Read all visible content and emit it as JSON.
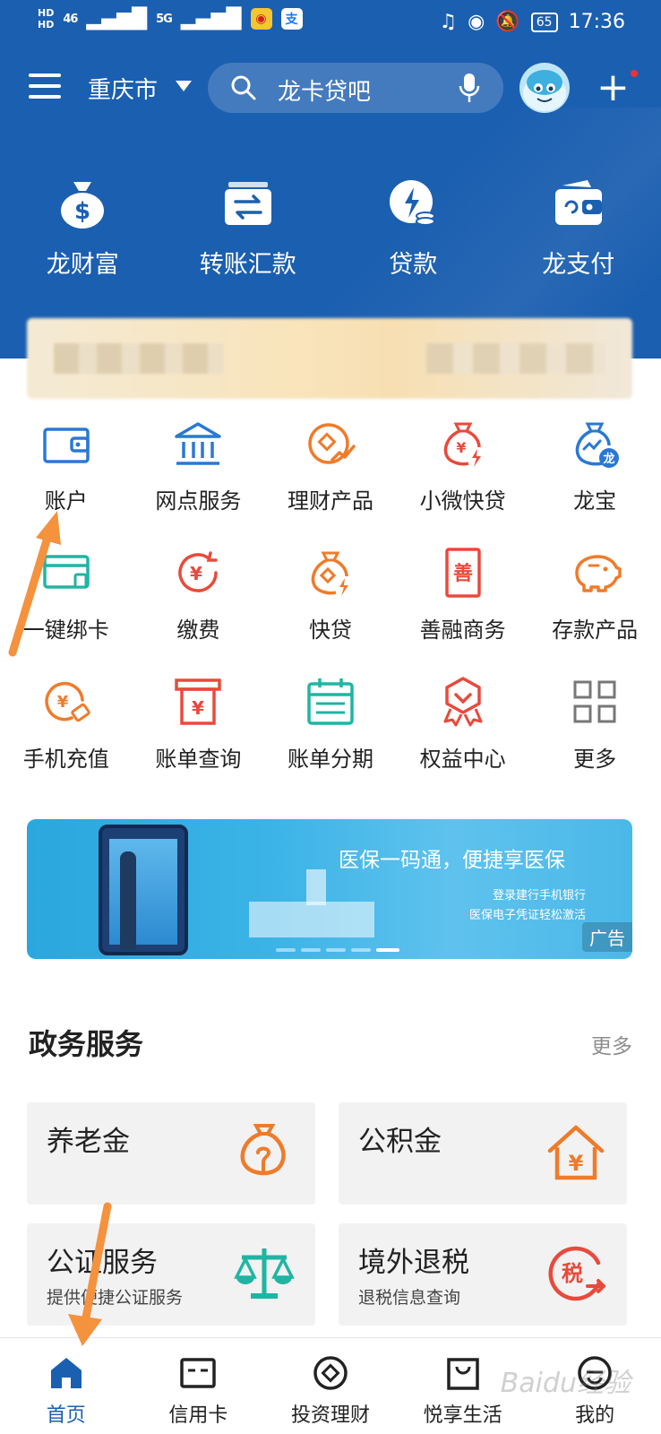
{
  "status_bar": {
    "hd1": "HD",
    "hd2": "HD",
    "sig1": "46",
    "sig2": "5G",
    "battery": "65",
    "time": "17:36"
  },
  "nav": {
    "city": "重庆市",
    "search_placeholder": "龙卡贷吧"
  },
  "quick": [
    {
      "label": "龙财富",
      "icon": "money-bag-icon"
    },
    {
      "label": "转账汇款",
      "icon": "transfer-icon"
    },
    {
      "label": "贷款",
      "icon": "loan-icon"
    },
    {
      "label": "龙支付",
      "icon": "wallet-icon"
    }
  ],
  "grid": [
    [
      {
        "label": "账户",
        "icon": "wallet-icon"
      },
      {
        "label": "网点服务",
        "icon": "bank-icon"
      },
      {
        "label": "理财产品",
        "icon": "coin-chart-icon"
      },
      {
        "label": "小微快贷",
        "icon": "money-bag-bolt-icon"
      },
      {
        "label": "龙宝",
        "icon": "dragon-bag-icon"
      }
    ],
    [
      {
        "label": "一键绑卡",
        "icon": "card-bind-icon"
      },
      {
        "label": "缴费",
        "icon": "yuan-circle-icon"
      },
      {
        "label": "快贷",
        "icon": "money-bag-bolt-icon"
      },
      {
        "label": "善融商务",
        "icon": "shan-icon"
      },
      {
        "label": "存款产品",
        "icon": "piggy-bank-icon"
      }
    ],
    [
      {
        "label": "手机充值",
        "icon": "recharge-icon"
      },
      {
        "label": "账单查询",
        "icon": "bill-query-icon"
      },
      {
        "label": "账单分期",
        "icon": "calendar-icon"
      },
      {
        "label": "权益中心",
        "icon": "badge-icon"
      },
      {
        "label": "更多",
        "icon": "grid-more-icon"
      }
    ]
  ],
  "banner": {
    "headline": "医保一码通，便捷享医保",
    "line1": "登录建行手机银行",
    "line2": "医保电子凭证轻松激活",
    "ad": "广告"
  },
  "gov": {
    "title": "政务服务",
    "more": "更多",
    "cards": [
      {
        "title": "养老金",
        "subtitle": "",
        "icon": "pension-bag-icon"
      },
      {
        "title": "公积金",
        "subtitle": "",
        "icon": "house-yuan-icon"
      },
      {
        "title": "公证服务",
        "subtitle": "提供便捷公证服务",
        "icon": "scale-icon"
      },
      {
        "title": "境外退税",
        "subtitle": "退税信息查询",
        "icon": "tax-refund-icon"
      }
    ]
  },
  "tabs": [
    {
      "label": "首页",
      "icon": "home-icon",
      "active": true
    },
    {
      "label": "信用卡",
      "icon": "credit-card-icon",
      "active": false
    },
    {
      "label": "投资理财",
      "icon": "invest-icon",
      "active": false
    },
    {
      "label": "悦享生活",
      "icon": "shopping-bag-icon",
      "active": false
    },
    {
      "label": "我的",
      "icon": "profile-icon",
      "active": false
    }
  ],
  "colors": {
    "brand_blue": "#1b5fb0",
    "icon_orange": "#ef7b2a",
    "icon_red": "#e84a3c",
    "icon_blue": "#2a78d4",
    "icon_teal": "#1fb5a3",
    "annotation_arrow": "#f5923e"
  },
  "watermark": "Baidu经验"
}
